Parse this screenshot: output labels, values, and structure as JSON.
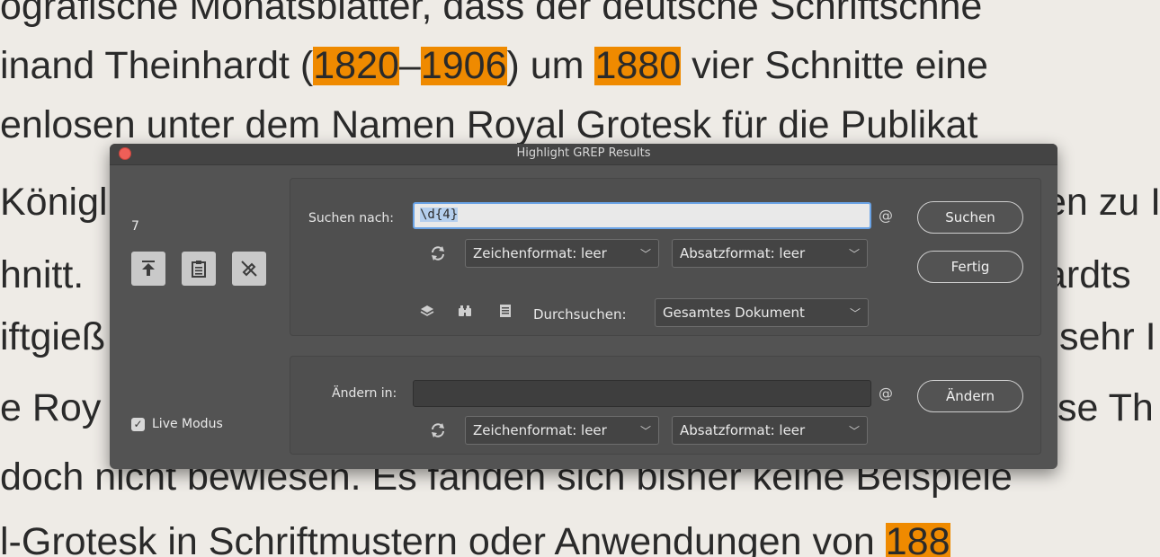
{
  "document": {
    "lines": [
      {
        "segments": [
          {
            "t": "ografische Monatsblätter, dass der deutsche Schriftschne",
            "h": false
          }
        ]
      },
      {
        "segments": [
          {
            "t": "inand Theinhardt (",
            "h": false
          },
          {
            "t": "1820",
            "h": true
          },
          {
            "t": "–",
            "h": false
          },
          {
            "t": "1906",
            "h": true
          },
          {
            "t": ") um ",
            "h": false
          },
          {
            "t": "1880",
            "h": true
          },
          {
            "t": " vier Schnitte eine",
            "h": false
          }
        ]
      },
      {
        "segments": [
          {
            "t": "enlosen unter dem Namen Royal Grotesk für die Publikat",
            "h": false
          }
        ]
      },
      {
        "segments": [
          {
            "t": "Königl",
            "h": false
          }
        ]
      },
      {
        "segments": [
          {
            "t": "hnitt.",
            "h": false
          }
        ]
      },
      {
        "segments": [
          {
            "t": "iftgieß",
            "h": false
          }
        ]
      },
      {
        "segments": [
          {
            "t": "e Roy",
            "h": false
          }
        ]
      },
      {
        "segments": [
          {
            "t": "doch nicht bewiesen. Es fanden sich bisher keine Beispiele",
            "h": false
          }
        ]
      },
      {
        "segments": [
          {
            "t": "l-Grotesk in Schriftmustern oder Anwendungen von ",
            "h": false
          },
          {
            "t": "188",
            "h": true
          }
        ]
      }
    ],
    "right_fragments": [
      "en zu I",
      "ardts",
      "sehr I",
      "se Th"
    ]
  },
  "dialog": {
    "title": "Highlight GREP Results",
    "result_count": "7",
    "live_mode_label": "Live Modus",
    "live_mode_checked": true,
    "find": {
      "label": "Suchen nach:",
      "value": "\\d{4}",
      "at_symbol": "@",
      "char_style": "Zeichenformat: leer",
      "para_style": "Absatzformat: leer",
      "search_label": "Durchsuchen:",
      "search_scope": "Gesamtes Dokument",
      "search_button": "Suchen",
      "done_button": "Fertig"
    },
    "change": {
      "label": "Ändern in:",
      "value": "",
      "at_symbol": "@",
      "char_style": "Zeichenformat: leer",
      "para_style": "Absatzformat: leer",
      "change_button": "Ändern"
    },
    "icons": {
      "tools": [
        "jump-to-top-icon",
        "clipboard-icon",
        "clear-highlight-icon"
      ],
      "swap": "swap-arrows-icon",
      "scope_icons": [
        "layers-icon",
        "binoculars-icon",
        "document-icon"
      ]
    }
  },
  "colors": {
    "highlight": "#ef8a00",
    "dialog_bg": "#535353",
    "paper": "#eeebe6",
    "focus": "#6aa3e6"
  }
}
